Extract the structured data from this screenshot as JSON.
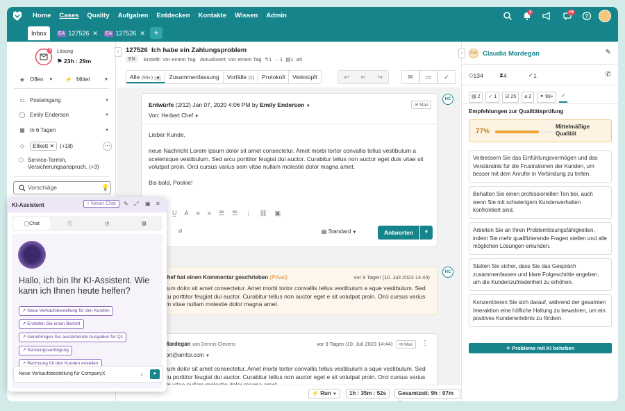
{
  "nav": {
    "links": [
      "Home",
      "Cases",
      "Quality",
      "Aufgaben",
      "Entdecken",
      "Kontakte",
      "Wissen",
      "Admin"
    ],
    "bell_badge": "3",
    "chat_badge": "+9"
  },
  "tabs": {
    "inbox": "Inbox",
    "t1_prefix": "EA",
    "t1": "127526",
    "t2_prefix": "EA",
    "t2": "127526",
    "plus": "+"
  },
  "left": {
    "badge": "3",
    "solution_label": "Lösung",
    "time": "23h : 29m",
    "status": "Offen",
    "priority": "Mittel",
    "mailbox": "Posteingang",
    "agent": "Emily Enderson",
    "due": "In 6 Tagen",
    "tag": "Etikett",
    "tag_more": "(+18)",
    "category": "Service-Termin, Versicherungsanspruch, (+3)",
    "search_placeholder": "Vorschläge"
  },
  "ai": {
    "title": "KI-Assistent",
    "new_chat": "+ Neuer Chat",
    "tab_chat": "Chat",
    "greeting": "Hallo, ich bin Ihr KI-Assistent. Wie kann ich Ihnen heute helfen?",
    "chips": [
      "Neue Verkaufsbestellung für den Kunden",
      "Erstellen Sie einen Bericht",
      "Genehmigen Sie ausstehende Ausgaben für Q1",
      "Sendungsverfolgung",
      "Rechnung für den Kunden erstellen"
    ],
    "input": "Neue Verkaufsbestellung für CompanyX"
  },
  "case": {
    "id": "127526",
    "title": "Ich habe ein Zahlungsproblem",
    "lang": "EN",
    "created": "Erstellt: Vor einem Tag",
    "updated": "Aktualisiert: Vor einem Tag",
    "c1": "1",
    "c2": "1",
    "c3": "1",
    "c4": "0"
  },
  "ctabs": {
    "all": "Alle",
    "all_count": "(99+)",
    "summary": "Zusammenfassung",
    "events": "Vorfälle",
    "events_count": "(2)",
    "protocol": "Protokoll",
    "linked": "Verknüpft"
  },
  "draft": {
    "label": "Entwürfe",
    "count": "(2/12)",
    "date": "Jan 07, 2020 4:06 PM",
    "by": "by",
    "author": "Emily Enderson",
    "mail_tag": "Mail",
    "from_label": "Von:",
    "from": "Herbert Chef",
    "greeting": "Lieber Kunde,",
    "body": "neue Nachricht Lorem ipsum dolor sit amet consectetur. Amet morbi tortor convallis tellus vestibulum a scelerisque vestibulum. Sed arcu porttitor feugiat dui auctor. Curabitur tellus non auctor eget duis vitae sit volutpat proin. Orci cursus varius sem vitae nullam molestie dolor magna amet.",
    "closing": "Bis bald, Pookie!",
    "more": "•••",
    "style": "Standard",
    "reply": "Antworten",
    "hc": "HC"
  },
  "comment": {
    "author": "t Chef",
    "action": "hat einen Kommentar geschrieben",
    "private": "(Privat)",
    "time": "vor 9 Tagen (10. Juli 2023 14:44)",
    "body": "ipsum dolor sit amet consectetur. Amet morbi tortor convallis tellus vestibulum a sque vestibulum. Sed arcu porttitor feugiat dui auctor. Curabitur tellus non auctor eget e sit volutpat proin. Orci cursus varius sem vitae nullam molestie dolor magna amet."
  },
  "message": {
    "author": "a Mardegan",
    "via": "von Dennis Clevens",
    "time": "vor 9 Tagen (10. Juli 2023 14:44)",
    "mail_tag": "Mail",
    "email": "pport@amfor.com",
    "body": "ipsum dolor sit amet consectetur. Amet morbi tortor convallis tellus vestibulum a sque vestibulum. Sed arcu porttitor feugiat dui auctor. Curabitur tellus non auctor eget e sit volutpat proin. Orci cursus varius sem vitae nullam molestie dolor magna amet."
  },
  "bottom": {
    "run": "Run",
    "timer": "1h : 35m : 52s",
    "total": "Gesamtzeit: 9h : 07m"
  },
  "right": {
    "initials": "CM",
    "name": "Claudia Mardegan",
    "s1": "134",
    "s2": "4",
    "s3": "1",
    "t1": "2",
    "t2": "1",
    "t3": "25",
    "t4": "2",
    "t5": "99+",
    "quality_title": "Empfehlungen zur Qualitätsprüfung",
    "score": "77%",
    "score_value": 0.77,
    "score_label": "Mittelmäßige Qualität",
    "recs": [
      "Verbessern Sie das Einfühlungsvermögen und das Verständnis für die Frustrationen der Kunden, um besser mit dem Anrufer in Verbindung zu treten.",
      "Behalten Sie einen professionellen Ton bei, auch wenn Sie mit schwierigem Kundenverhalten konfrontiert sind.",
      "Arbeiten Sie an Ihren Problemlösungsfähigkeiten, indem Sie mehr qualifizierende Fragen stellen und alle möglichen Lösungen erkunden.",
      "Stellen Sie sicher, dass Sie das Gespräch zusammenfassen und klare Folgeschritte angeben, um die Kundenzufriedenheit zu erhöhen.",
      "Konzentrieren Sie sich darauf, während der gesamten Interaktion eine höfliche Haltung zu bewahren, um ein positives Kundenerlebnis zu fördern."
    ],
    "ki_button": "Probleme mit KI beheben"
  },
  "colors": {
    "primary": "#16848b",
    "accent_purple": "#8e6bbf",
    "badge_red": "#e84a5f",
    "quality_orange": "#f2a33a"
  }
}
